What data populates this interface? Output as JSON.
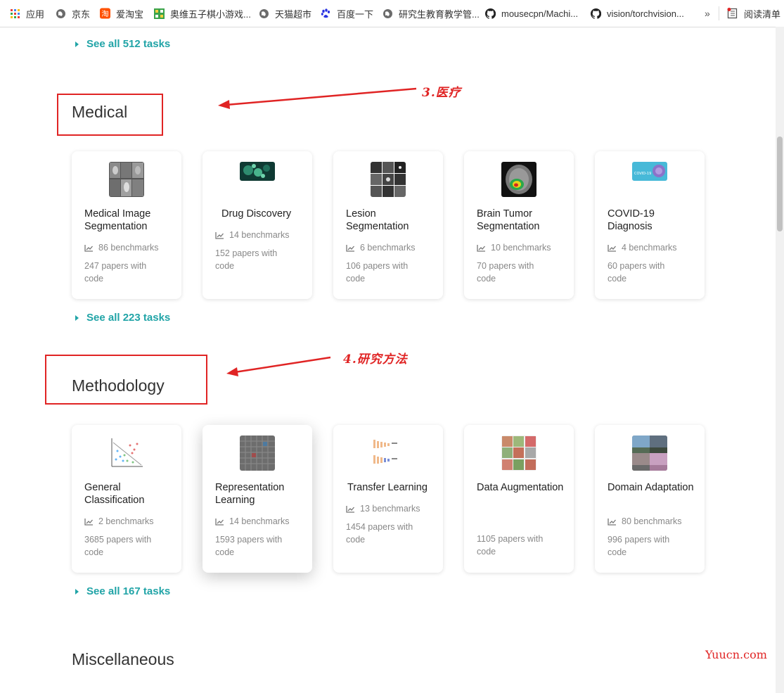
{
  "bookmarks": [
    {
      "label": "应用",
      "icon": "apps-grid-icon"
    },
    {
      "label": "京东",
      "icon": "globe-icon"
    },
    {
      "label": "爱淘宝",
      "icon": "taobao-icon"
    },
    {
      "label": "奥维五子棋小游戏...",
      "icon": "game-icon"
    },
    {
      "label": "天猫超市",
      "icon": "globe-icon"
    },
    {
      "label": "百度一下",
      "icon": "baidu-paw-icon"
    },
    {
      "label": "研究生教育教学管...",
      "icon": "globe-icon"
    },
    {
      "label": "mousecpn/Machi...",
      "icon": "github-icon"
    },
    {
      "label": "vision/torchvision...",
      "icon": "github-icon"
    }
  ],
  "bookmarks_more": "»",
  "reading_list": {
    "label": "阅读清单",
    "icon": "reading-list-icon"
  },
  "top_see_all": "See all 512 tasks",
  "sections": [
    {
      "title": "Medical",
      "annotation": "3.医疗",
      "see_all": "See all 223 tasks",
      "cards": [
        {
          "title": "Medical Image Segmentation",
          "benchmarks": "86 benchmarks",
          "papers": "247 papers with code"
        },
        {
          "title": "Drug Discovery",
          "benchmarks": "14 benchmarks",
          "papers": "152 papers with code"
        },
        {
          "title": "Lesion Segmentation",
          "benchmarks": "6 benchmarks",
          "papers": "106 papers with code"
        },
        {
          "title": "Brain Tumor Segmentation",
          "benchmarks": "10 benchmarks",
          "papers": "70 papers with code"
        },
        {
          "title": "COVID-19 Diagnosis",
          "benchmarks": "4 benchmarks",
          "papers": "60 papers with code"
        }
      ]
    },
    {
      "title": "Methodology",
      "annotation": "4.研究方法",
      "see_all": "See all 167 tasks",
      "cards": [
        {
          "title": "General Classification",
          "benchmarks": "2 benchmarks",
          "papers": "3685 papers with code"
        },
        {
          "title": "Representation Learning",
          "benchmarks": "14 benchmarks",
          "papers": "1593 papers with code"
        },
        {
          "title": "Transfer Learning",
          "benchmarks": "13 benchmarks",
          "papers": "1454 papers with code"
        },
        {
          "title": "Data Augmentation",
          "benchmarks": "",
          "papers": "1105 papers with code"
        },
        {
          "title": "Domain Adaptation",
          "benchmarks": "80 benchmarks",
          "papers": "996 papers with code"
        }
      ]
    },
    {
      "title": "Miscellaneous"
    }
  ],
  "watermark": "Yuucn.com",
  "colors": {
    "accent": "#21a4a7",
    "annotation_red": "#e02424"
  }
}
